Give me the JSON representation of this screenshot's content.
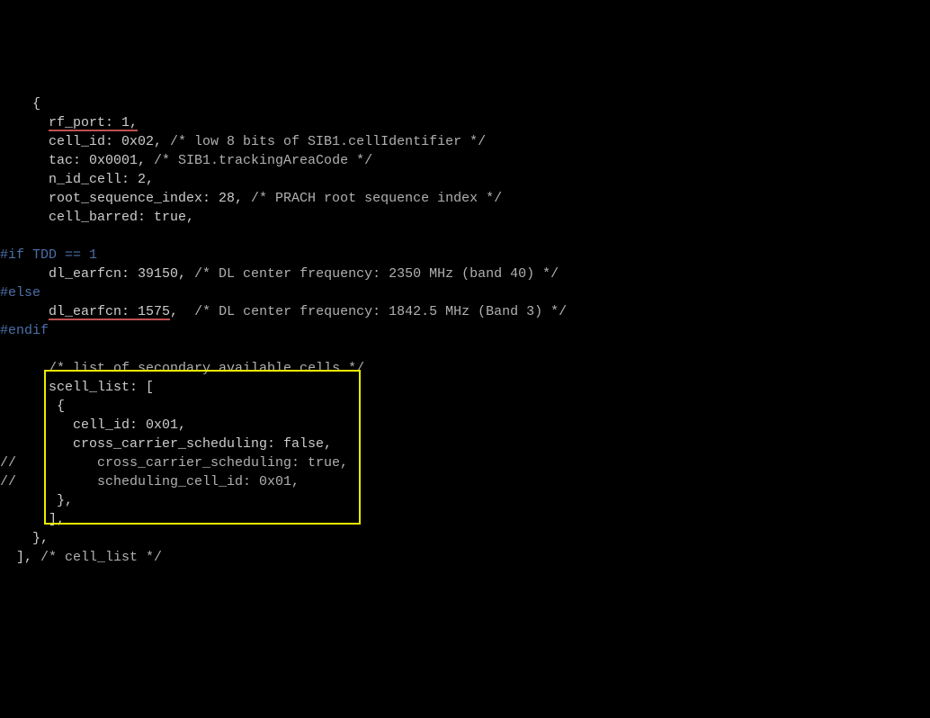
{
  "lines": {
    "l01": "    {",
    "l02a": "      ",
    "l02b": "rf_port: 1,",
    "l03a": "      cell_id: 0x02, ",
    "l03b": "/* low 8 bits of SIB1.cellIdentifier */",
    "l04a": "      tac: 0x0001, ",
    "l04b": "/* SIB1.trackingAreaCode */",
    "l05": "      n_id_cell: 2,",
    "l06a": "      root_sequence_index: 28, ",
    "l06b": "/* PRACH root sequence index */",
    "l07": "      cell_barred: true,",
    "l08": "",
    "l09": "#if TDD == 1",
    "l10a": "      dl_earfcn: 39150, ",
    "l10b": "/* DL center frequency: 2350 MHz (band 40) */",
    "l11": "#else",
    "l12a": "      ",
    "l12b": "dl_earfcn: 1575",
    "l12c": ",  ",
    "l12d": "/* DL center frequency: 1842.5 MHz (Band 3) */",
    "l13": "#endif",
    "l14": "",
    "l15a": "      ",
    "l15b": "/* list of secondary available cells */",
    "l16": "      scell_list: [",
    "l17": "       {",
    "l18": "         cell_id: 0x01,",
    "l19": "         cross_carrier_scheduling: false,",
    "l20": "//          cross_carrier_scheduling: true,",
    "l21": "//          scheduling_cell_id: 0x01,",
    "l22": "       },",
    "l23": "      ],",
    "l24": "    },",
    "l25a": "  ], ",
    "l25b": "/* cell_list */"
  }
}
